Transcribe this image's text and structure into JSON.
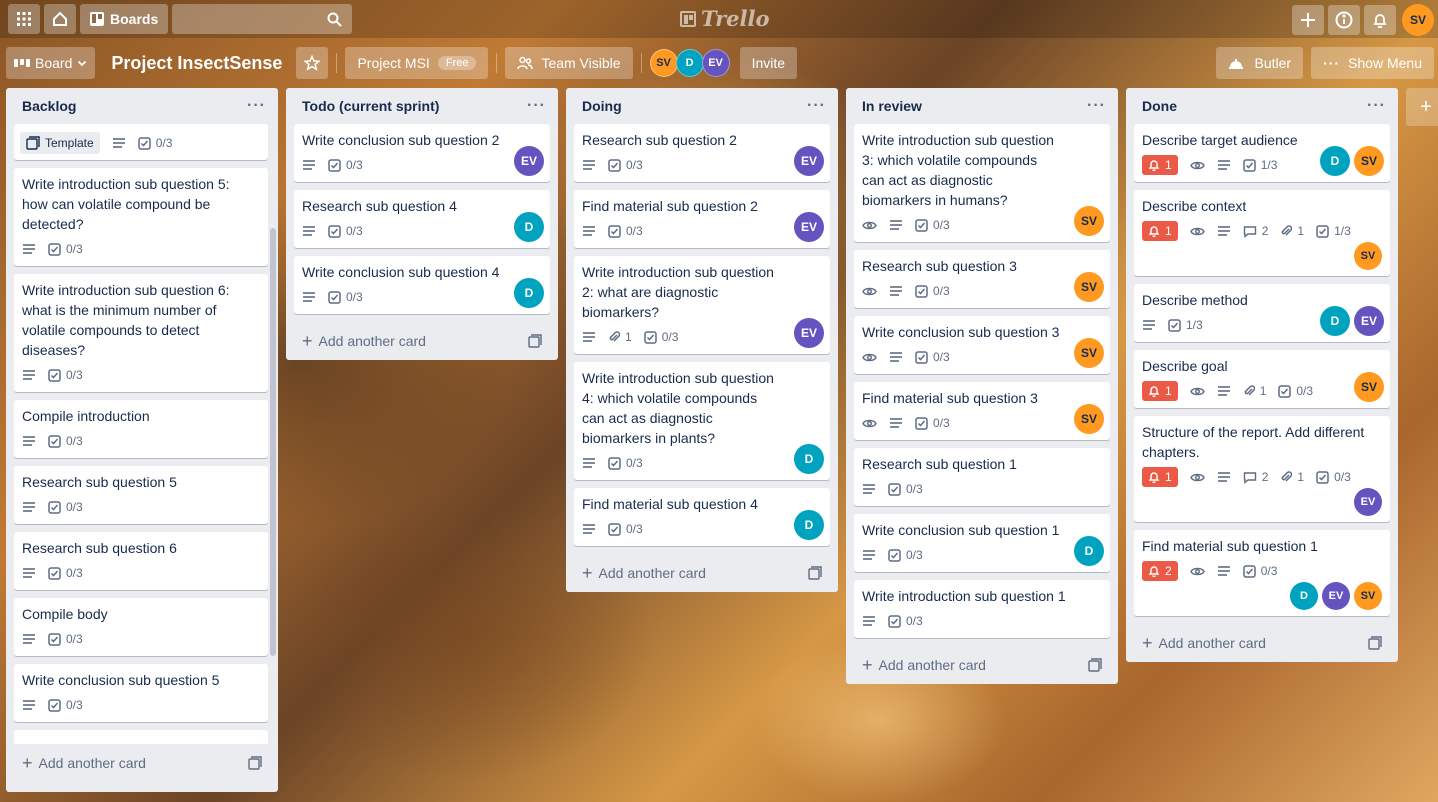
{
  "topbar": {
    "boards_label": "Boards",
    "search_placeholder": "",
    "logo_text": "Trello",
    "user_initials": "SV"
  },
  "board": {
    "view_label": "Board",
    "title": "Project InsectSense",
    "team_name": "Project MSI",
    "team_badge": "Free",
    "visibility": "Team Visible",
    "members": [
      "SV",
      "D",
      "EV"
    ],
    "invite_label": "Invite",
    "butler_label": "Butler",
    "show_menu_label": "Show Menu"
  },
  "add_card_label": "Add another card",
  "lists": [
    {
      "title": "Backlog",
      "cards": [
        {
          "template_label": "Template",
          "checklist": "0/3"
        },
        {
          "title": "Write introduction sub question 5: how can volatile compound be detected?",
          "checklist": "0/3"
        },
        {
          "title": "Write introduction sub question 6: what is the minimum number of volatile compounds to detect diseases?",
          "checklist": "0/3"
        },
        {
          "title": "Compile introduction",
          "checklist": "0/3"
        },
        {
          "title": "Research sub question 5",
          "checklist": "0/3"
        },
        {
          "title": "Research sub question 6",
          "checklist": "0/3"
        },
        {
          "title": "Compile body",
          "checklist": "0/3"
        },
        {
          "title": "Write conclusion sub question 5",
          "checklist": "0/3"
        }
      ]
    },
    {
      "title": "Todo (current sprint)",
      "cards": [
        {
          "title": "Write conclusion sub question 2",
          "checklist": "0/3",
          "member": "EV"
        },
        {
          "title": "Research sub question 4",
          "checklist": "0/3",
          "member": "D"
        },
        {
          "title": "Write conclusion sub question 4",
          "checklist": "0/3",
          "member": "D"
        }
      ]
    },
    {
      "title": "Doing",
      "cards": [
        {
          "title": "Research sub question 2",
          "checklist": "0/3",
          "member": "EV"
        },
        {
          "title": "Find material sub question 2",
          "checklist": "0/3",
          "member": "EV"
        },
        {
          "title": "Write introduction sub question 2: what are diagnostic biomarkers?",
          "attachments": "1",
          "checklist": "0/3",
          "member": "EV"
        },
        {
          "title": "Write introduction sub question 4: which volatile compounds can act as diagnostic biomarkers in plants?",
          "checklist": "0/3",
          "member": "D"
        },
        {
          "title": "Find material sub question 4",
          "checklist": "0/3",
          "member": "D"
        }
      ]
    },
    {
      "title": "In review",
      "cards": [
        {
          "title": "Write introduction sub question 3: which volatile compounds can act as diagnostic biomarkers in humans?",
          "checklist": "0/3",
          "member": "SV"
        },
        {
          "title": "Research sub question 3",
          "checklist": "0/3",
          "member": "SV"
        },
        {
          "title": "Write conclusion sub question 3",
          "checklist": "0/3",
          "member": "SV"
        },
        {
          "title": "Find material sub question 3",
          "checklist": "0/3",
          "member": "SV"
        },
        {
          "title": "Research sub question 1",
          "checklist": "0/3"
        },
        {
          "title": "Write conclusion sub question 1",
          "checklist": "0/3",
          "member": "D"
        },
        {
          "title": "Write introduction sub question 1",
          "checklist": "0/3"
        }
      ]
    },
    {
      "title": "Done",
      "cards": [
        {
          "title": "Describe target audience",
          "due": "1",
          "checklist": "1/3",
          "members": [
            "D",
            "SV"
          ]
        },
        {
          "title": "Describe context",
          "due": "1",
          "comments": "2",
          "attachments": "1",
          "checklist": "1/3",
          "members": [
            "SV"
          ]
        },
        {
          "title": "Describe method",
          "checklist": "1/3",
          "members": [
            "D",
            "EV"
          ]
        },
        {
          "title": "Describe goal",
          "due": "1",
          "attachments": "1",
          "checklist": "0/3",
          "members": [
            "SV"
          ]
        },
        {
          "title": "Structure of the report. Add different chapters.",
          "due": "1",
          "comments": "2",
          "attachments": "1",
          "checklist": "0/3",
          "members": [
            "EV"
          ]
        },
        {
          "title": "Find material sub question 1",
          "due": "2",
          "checklist": "0/3",
          "members": [
            "D",
            "EV",
            "SV"
          ]
        }
      ]
    }
  ],
  "colors": {
    "sv": "#ff991f",
    "d": "#00a3bf",
    "ev": "#6554c0",
    "due_badge": "#eb5a46"
  }
}
